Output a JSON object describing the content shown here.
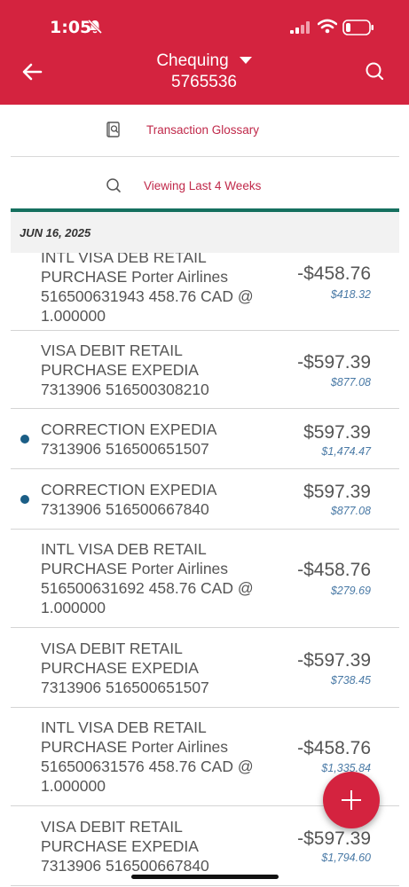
{
  "status_bar": {
    "time": "1:05"
  },
  "header": {
    "account_name": "Chequing",
    "account_number": "5765536"
  },
  "actions": {
    "glossary_label": "Transaction Glossary",
    "viewing_label": "Viewing Last 4 Weeks"
  },
  "date_header": "JUN 16, 2025",
  "transactions": [
    {
      "lines": [
        "INTL VISA DEB RETAIL",
        "PURCHASE Porter Airlines",
        "516500631943 458.76 CAD @",
        "1.000000"
      ],
      "amount": "-$458.76",
      "balance": "$418.32",
      "dot": false
    },
    {
      "lines": [
        "VISA DEBIT RETAIL",
        "PURCHASE EXPEDIA",
        "7313906   516500308210"
      ],
      "amount": "-$597.39",
      "balance": "$877.08",
      "dot": false
    },
    {
      "lines": [
        "CORRECTION EXPEDIA",
        "7313906   516500651507"
      ],
      "amount": "$597.39",
      "balance": "$1,474.47",
      "dot": true
    },
    {
      "lines": [
        "CORRECTION EXPEDIA",
        "7313906   516500667840"
      ],
      "amount": "$597.39",
      "balance": "$877.08",
      "dot": true
    },
    {
      "lines": [
        "INTL VISA DEB RETAIL",
        "PURCHASE Porter Airlines",
        "516500631692 458.76 CAD @",
        "1.000000"
      ],
      "amount": "-$458.76",
      "balance": "$279.69",
      "dot": false
    },
    {
      "lines": [
        "VISA DEBIT RETAIL",
        "PURCHASE EXPEDIA",
        "7313906   516500651507"
      ],
      "amount": "-$597.39",
      "balance": "$738.45",
      "dot": false
    },
    {
      "lines": [
        "INTL VISA DEB RETAIL",
        "PURCHASE Porter Airlines",
        "516500631576 458.76 CAD @",
        "1.000000"
      ],
      "amount": "-$458.76",
      "balance": "$1,335.84",
      "dot": false
    },
    {
      "lines": [
        "VISA DEBIT RETAIL",
        "PURCHASE EXPEDIA",
        "7313906   516500667840"
      ],
      "amount": "-$597.39",
      "balance": "$1,794.60",
      "dot": false
    }
  ],
  "colors": {
    "brand_red": "#d4233f",
    "accent_teal": "#15705f",
    "unread_dot": "#1b5e86",
    "balance_blue": "#4a7aa6",
    "link_red": "#c0294a"
  },
  "icons": {
    "back": "arrow-left-icon",
    "dropdown": "caret-down-icon",
    "search": "search-icon",
    "glossary": "glossary-book-icon",
    "filter": "search-filter-icon",
    "add": "plus-icon"
  }
}
